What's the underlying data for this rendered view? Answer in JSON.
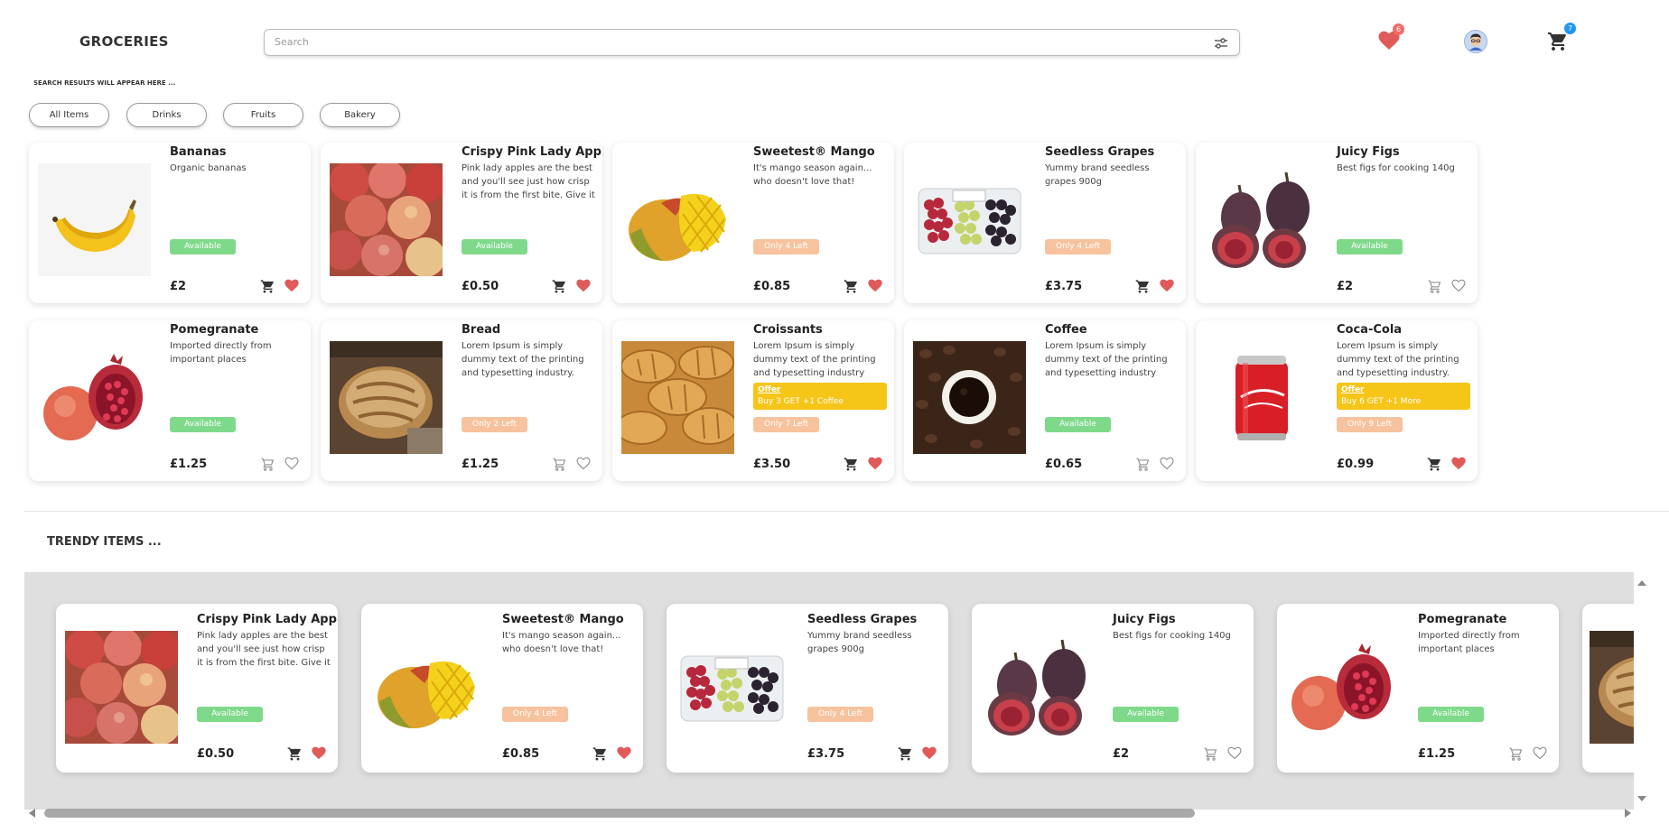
{
  "header": {
    "logo": "GROCERIES",
    "search_placeholder": "Search",
    "wishlist_count": "6",
    "cart_count": "7"
  },
  "search_results_note": "SEARCH RESULTS WILL APPEAR HERE ...",
  "categories": [
    "All Items",
    "Drinks",
    "Fruits",
    "Bakery"
  ],
  "products": [
    {
      "title": "Bananas",
      "desc": "Organic bananas",
      "status": "Available",
      "status_type": "avail",
      "price": "£2",
      "image": "banana",
      "fav": true,
      "cart_dark": true
    },
    {
      "title": "Crispy Pink Lady Apples",
      "desc": "Pink lady apples are the best and you'll see just how crisp it is from the first bite. Give it a try, what",
      "status": "Available",
      "status_type": "avail",
      "price": "£0.50",
      "image": "apples",
      "fav": true,
      "cart_dark": true
    },
    {
      "title": "Sweetest® Mango",
      "desc": "It's mango season again... who doesn't love that!",
      "status": "Only 4 Left",
      "status_type": "left",
      "price": "£0.85",
      "image": "mango",
      "fav": true,
      "cart_dark": true
    },
    {
      "title": "Seedless Grapes",
      "desc": "Yummy brand seedless grapes 900g",
      "status": "Only 4 Left",
      "status_type": "left",
      "price": "£3.75",
      "image": "grapes",
      "fav": true,
      "cart_dark": true
    },
    {
      "title": "Juicy Figs",
      "desc": "Best figs for cooking 140g",
      "status": "Available",
      "status_type": "avail",
      "price": "£2",
      "image": "figs",
      "fav": false,
      "cart_dark": false
    },
    {
      "title": "Pomegranate",
      "desc": "Imported directly from important places",
      "status": "Available",
      "status_type": "avail",
      "price": "£1.25",
      "image": "pomegranate",
      "fav": false,
      "cart_dark": false
    },
    {
      "title": "Bread",
      "desc": "Lorem Ipsum is simply dummy text of the printing and typesetting industry. Lorem",
      "status": "Only 2 Left",
      "status_type": "left",
      "price": "£1.25",
      "image": "bread",
      "fav": false,
      "cart_dark": false
    },
    {
      "title": "Croissants",
      "desc": "Lorem Ipsum is simply dummy text of the printing and typesetting industry",
      "status": "Only 7 Left",
      "status_type": "left",
      "price": "£3.50",
      "image": "croissants",
      "fav": true,
      "cart_dark": true,
      "offer": {
        "label": "Offer",
        "text": "Buy 3  GET +1  Coffee"
      }
    },
    {
      "title": "Coffee",
      "desc": "Lorem Ipsum is simply dummy text of the printing and typesetting industry",
      "status": "Available",
      "status_type": "avail",
      "price": "£0.65",
      "image": "coffee",
      "fav": false,
      "cart_dark": false
    },
    {
      "title": "Coca-Cola",
      "desc": "Lorem Ipsum is simply dummy text of the printing and typesetting industry. Lorem",
      "status": "Only 9 Left",
      "status_type": "left",
      "price": "£0.99",
      "image": "cola",
      "fav": true,
      "cart_dark": true,
      "offer": {
        "label": "Offer",
        "text": "Buy 6  GET +1  More"
      }
    }
  ],
  "trendy": {
    "title": "TRENDY ITEMS ...",
    "items": [
      {
        "title": "Crispy Pink Lady Apples",
        "desc": "Pink lady apples are the best and you'll see just how crisp it is from the first bite. Give it a try, what",
        "status": "Available",
        "status_type": "avail",
        "price": "£0.50",
        "image": "apples",
        "fav": true,
        "cart_dark": true
      },
      {
        "title": "Sweetest® Mango",
        "desc": "It's mango season again... who doesn't love that!",
        "status": "Only 4 Left",
        "status_type": "left",
        "price": "£0.85",
        "image": "mango",
        "fav": true,
        "cart_dark": true
      },
      {
        "title": "Seedless Grapes",
        "desc": "Yummy brand seedless grapes 900g",
        "status": "Only 4 Left",
        "status_type": "left",
        "price": "£3.75",
        "image": "grapes",
        "fav": true,
        "cart_dark": true
      },
      {
        "title": "Juicy Figs",
        "desc": "Best figs for cooking 140g",
        "status": "Available",
        "status_type": "avail",
        "price": "£2",
        "image": "figs",
        "fav": false,
        "cart_dark": false
      },
      {
        "title": "Pomegranate",
        "desc": "Imported directly from important places",
        "status": "Available",
        "status_type": "avail",
        "price": "£1.25",
        "image": "pomegranate",
        "fav": false,
        "cart_dark": false
      },
      {
        "title": "",
        "desc": "",
        "status": "",
        "status_type": "avail",
        "price": "",
        "image": "bread",
        "fav": false,
        "cart_dark": false,
        "partial": true
      }
    ]
  },
  "colors": {
    "available": "#7fd98b",
    "low_stock": "#f7c29e",
    "offer": "#f5c518",
    "heart": "#e05a5a",
    "wishlist_badge": "#f26b6b",
    "cart_badge": "#2196f3",
    "panel": "#dfdfdf"
  }
}
